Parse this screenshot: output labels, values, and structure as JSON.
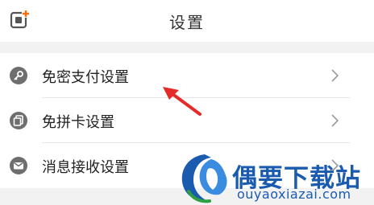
{
  "header": {
    "title": "设置",
    "left_icon": "add-square-icon"
  },
  "settings": {
    "items": [
      {
        "label": "免密支付设置",
        "icon": "key-icon"
      },
      {
        "label": "免拼卡设置",
        "icon": "card-icon"
      },
      {
        "label": "消息接收设置",
        "icon": "mail-icon"
      }
    ]
  },
  "watermark": {
    "name": "偶要下载站",
    "domain": "ouyaoxiazai.com"
  },
  "colors": {
    "accent": "#ff6a00",
    "arrow": "#e52a2a",
    "watermark": "#1a5bb0",
    "icon_gray": "#6e6e6e"
  }
}
